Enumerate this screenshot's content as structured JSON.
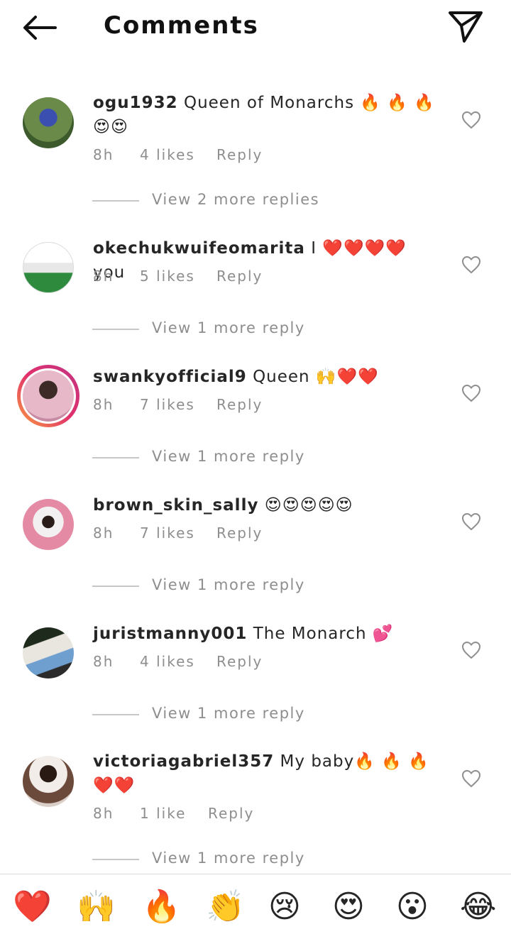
{
  "header": {
    "title": "Comments",
    "back_icon": "arrow-left-icon",
    "send_icon": "paper-plane-icon"
  },
  "comments": [
    {
      "username": "ogu1932",
      "text": "Queen of Monarchs 🔥 🔥 🔥 😍😍",
      "time": "8h",
      "likes": "4 likes",
      "reply": "Reply",
      "view_replies": "View 2 more replies"
    },
    {
      "username": "okechukwuifeomarita",
      "text": "I ❤️❤️❤️❤️ you",
      "time": "8h",
      "likes": "5 likes",
      "reply": "Reply",
      "view_replies": "View 1 more reply"
    },
    {
      "username": "swankyofficial9",
      "text": "Queen 🙌❤️❤️",
      "time": "8h",
      "likes": "7 likes",
      "reply": "Reply",
      "view_replies": "View 1 more reply"
    },
    {
      "username": "brown_skin_sally",
      "text": "😍😍😍😍😍",
      "time": "8h",
      "likes": "7 likes",
      "reply": "Reply",
      "view_replies": "View 1 more reply"
    },
    {
      "username": "juristmanny001",
      "text": "The Monarch 💕",
      "time": "8h",
      "likes": "4 likes",
      "reply": "Reply",
      "view_replies": "View 1 more reply"
    },
    {
      "username": "victoriagabriel357",
      "text": "My baby🔥 🔥 🔥❤️❤️",
      "time": "8h",
      "likes": "1 like",
      "reply": "Reply",
      "view_replies": "View 1 more reply"
    }
  ],
  "emoji_bar": [
    "❤️",
    "🙌",
    "🔥",
    "👏",
    "😢",
    "😍",
    "😮",
    "😂"
  ],
  "colors": {
    "text": "#262626",
    "muted": "#8e8e8e",
    "divider": "#dbdbdb"
  }
}
